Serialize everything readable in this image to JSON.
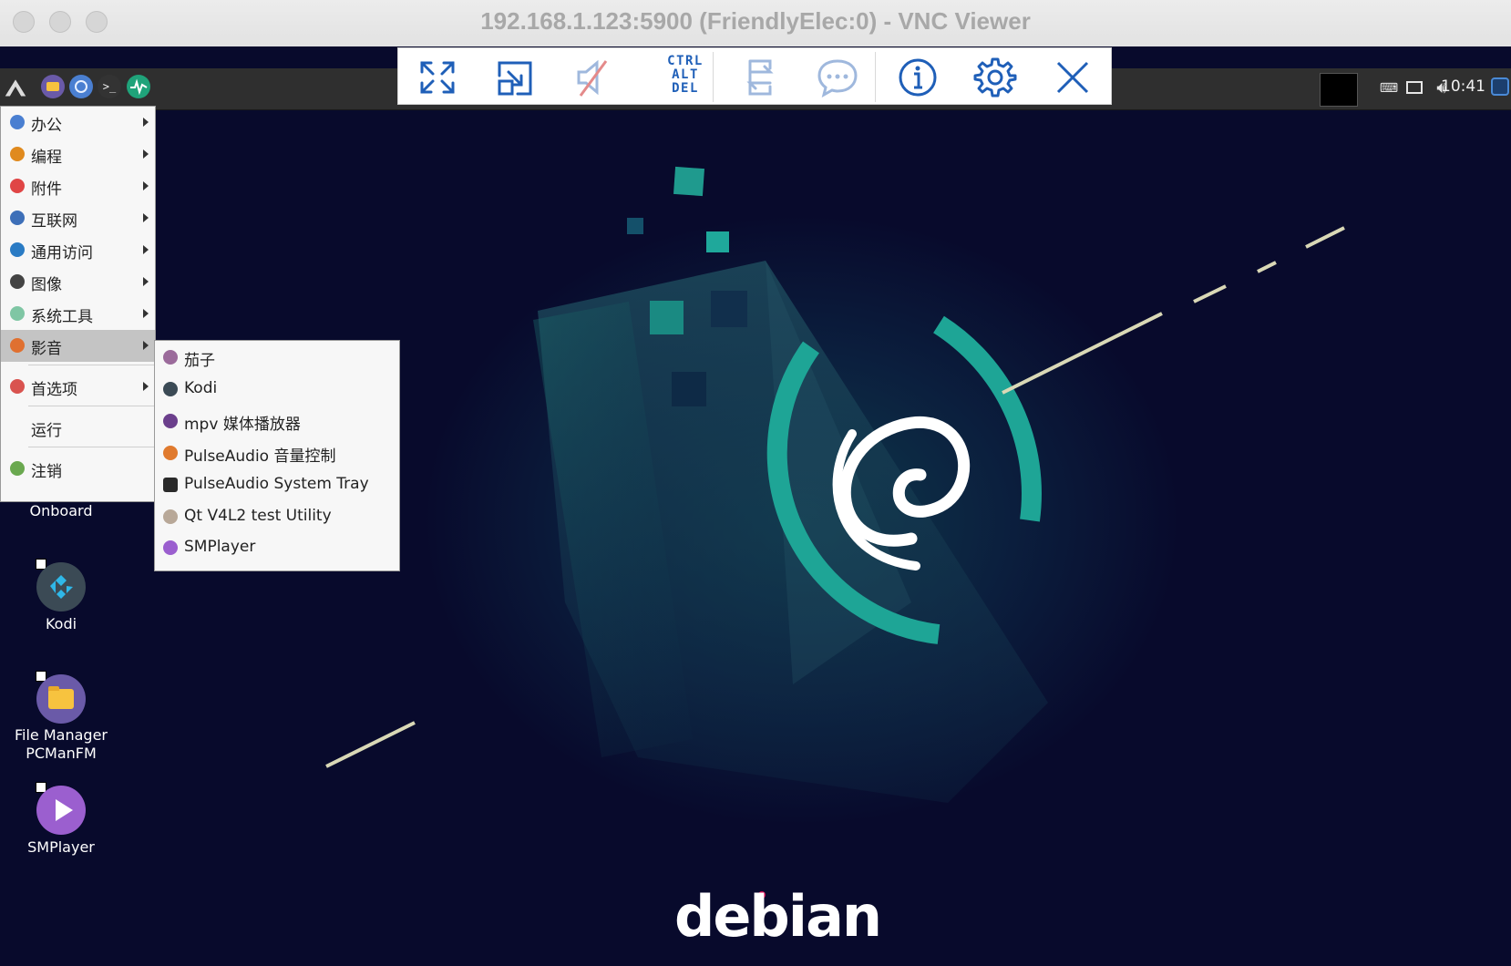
{
  "window": {
    "title": "192.168.1.123:5900 (FriendlyElec:0) - VNC Viewer"
  },
  "vnc_toolbar": {
    "buttons": [
      {
        "name": "full-screen-icon"
      },
      {
        "name": "scale-to-fit-icon"
      },
      {
        "name": "mute-audio-icon"
      },
      {
        "name": "ctrl-alt-del",
        "label_lines": [
          "CTRL",
          "ALT",
          "DEL"
        ]
      },
      {
        "name": "transfer-files-icon"
      },
      {
        "name": "chat-icon"
      },
      {
        "name": "info-icon"
      },
      {
        "name": "settings-gear-icon"
      },
      {
        "name": "close-icon"
      }
    ],
    "accent_color": "#1f5fb8"
  },
  "panel": {
    "clock": "10:41",
    "launchers": [
      "lxde-menu-icon",
      "file-manager-icon",
      "browser-icon",
      "terminal-icon",
      "system-monitor-icon"
    ]
  },
  "main_menu": {
    "items": [
      {
        "label": "办公",
        "icon": "office-icon",
        "color": "#4a7fd1",
        "submenu": true
      },
      {
        "label": "编程",
        "icon": "programming-icon",
        "color": "#e08a1e",
        "submenu": true
      },
      {
        "label": "附件",
        "icon": "accessories-icon",
        "color": "#e04545",
        "submenu": true
      },
      {
        "label": "互联网",
        "icon": "internet-icon",
        "color": "#3d6fb8",
        "submenu": true
      },
      {
        "label": "通用访问",
        "icon": "accessibility-icon",
        "color": "#2a7bc4",
        "submenu": true
      },
      {
        "label": "图像",
        "icon": "graphics-icon",
        "color": "#444444",
        "submenu": true
      },
      {
        "label": "系统工具",
        "icon": "system-tools-icon",
        "color": "#7fc6a4",
        "submenu": true
      },
      {
        "label": "影音",
        "icon": "multimedia-icon",
        "color": "#e07030",
        "submenu": true,
        "active": true
      },
      {
        "label": "首选项",
        "icon": "preferences-icon",
        "color": "#d9534f",
        "submenu": true
      },
      {
        "label": "运行",
        "icon": "",
        "color": "",
        "submenu": false
      },
      {
        "label": "注销",
        "icon": "logout-icon",
        "color": "#6aa84f",
        "submenu": false
      }
    ]
  },
  "sub_menu": {
    "items": [
      {
        "label": "茄子",
        "icon": "cheese-icon",
        "color": "#9b6b9b"
      },
      {
        "label": "Kodi",
        "icon": "kodi-icon",
        "color": "#3b4a55"
      },
      {
        "label": "mpv 媒体播放器",
        "icon": "mpv-icon",
        "color": "#6b3f8c"
      },
      {
        "label": "PulseAudio 音量控制",
        "icon": "pulseaudio-volume-icon",
        "color": "#e07a2e"
      },
      {
        "label": "PulseAudio System Tray",
        "icon": "pulseaudio-tray-icon",
        "color": "#2a2a2a"
      },
      {
        "label": "Qt V4L2 test Utility",
        "icon": "qt-v4l2-icon",
        "color": "#b8a898"
      },
      {
        "label": "SMPlayer",
        "icon": "smplayer-icon",
        "color": "#9b5fcf"
      }
    ]
  },
  "desktop_icons": [
    {
      "label": "Onboard",
      "icon": "onboard-keyboard-icon"
    },
    {
      "label": "Kodi",
      "icon": "kodi-icon",
      "color": "#3b4a55"
    },
    {
      "label": "File Manager\nPCManFM",
      "label1": "File Manager",
      "label2": "PCManFM",
      "icon": "folder-icon",
      "color": "#6a5aa8"
    },
    {
      "label": "SMPlayer",
      "icon": "smplayer-icon",
      "color": "#9b5fcf"
    }
  ],
  "wallpaper": {
    "brand": "debian",
    "accent": "#1fa393"
  }
}
